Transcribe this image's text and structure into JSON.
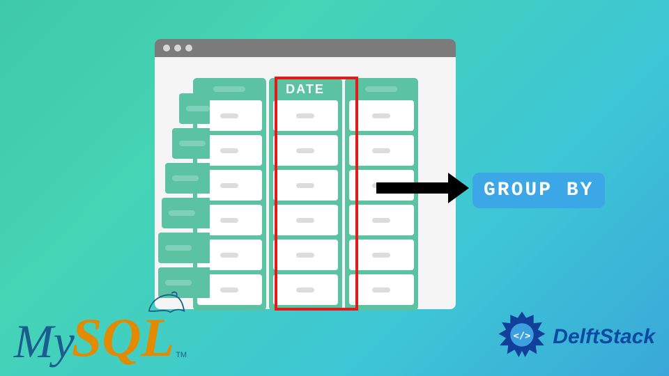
{
  "diagram": {
    "window": {
      "title_dots": 3
    },
    "columns": {
      "highlighted_label": "DATE",
      "col2_label": "",
      "col3_label": ""
    },
    "highlight_color": "#e11b1b",
    "arrow_target_label": "GROUP BY"
  },
  "logos": {
    "mysql": {
      "part1": "My",
      "part2": "SQL",
      "tm": "TM"
    },
    "delftstack": {
      "text": "DelftStack",
      "glyph": "</>"
    }
  },
  "colors": {
    "accent_teal": "#5bc3a2",
    "group_by_bg": "#3ca7e6",
    "mysql_blue": "#1b5d8f",
    "mysql_orange": "#e48a00",
    "delft_blue": "#0a4aa3"
  }
}
